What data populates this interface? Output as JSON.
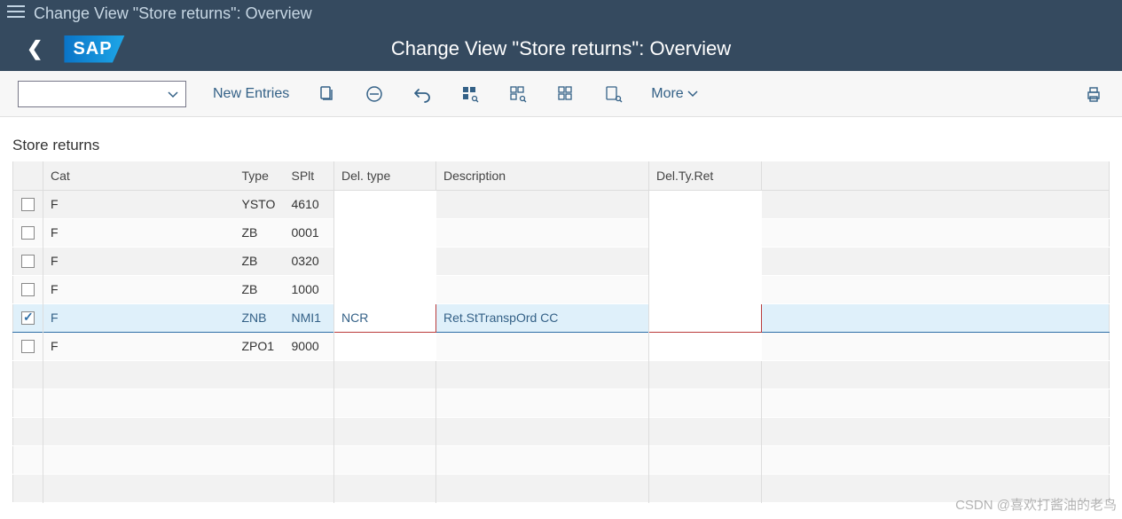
{
  "shell": {
    "title": "Change View \"Store returns\": Overview"
  },
  "header": {
    "title": "Change View \"Store returns\": Overview",
    "logo": "SAP"
  },
  "toolbar": {
    "new_entries": "New Entries",
    "more": "More"
  },
  "group": {
    "title": "Store returns"
  },
  "columns": {
    "cat": "Cat",
    "type": "Type",
    "splt": "SPlt",
    "deltype": "Del. type",
    "desc": "Description",
    "delret": "Del.Ty.Ret"
  },
  "rows": [
    {
      "checked": false,
      "cat": "F",
      "type": "YSTO",
      "splt": "4610",
      "deltype": "",
      "desc": "",
      "delret": ""
    },
    {
      "checked": false,
      "cat": "F",
      "type": "ZB",
      "splt": "0001",
      "deltype": "",
      "desc": "",
      "delret": ""
    },
    {
      "checked": false,
      "cat": "F",
      "type": "ZB",
      "splt": "0320",
      "deltype": "",
      "desc": "",
      "delret": ""
    },
    {
      "checked": false,
      "cat": "F",
      "type": "ZB",
      "splt": "1000",
      "deltype": "",
      "desc": "",
      "delret": ""
    },
    {
      "checked": true,
      "cat": "F",
      "type": "ZNB",
      "splt": "NMI1",
      "deltype": "NCR",
      "desc": "Ret.StTranspOrd CC",
      "delret": ""
    },
    {
      "checked": false,
      "cat": "F",
      "type": "ZPO1",
      "splt": "9000",
      "deltype": "",
      "desc": "",
      "delret": ""
    }
  ],
  "watermark": "CSDN @喜欢打酱油的老鸟"
}
